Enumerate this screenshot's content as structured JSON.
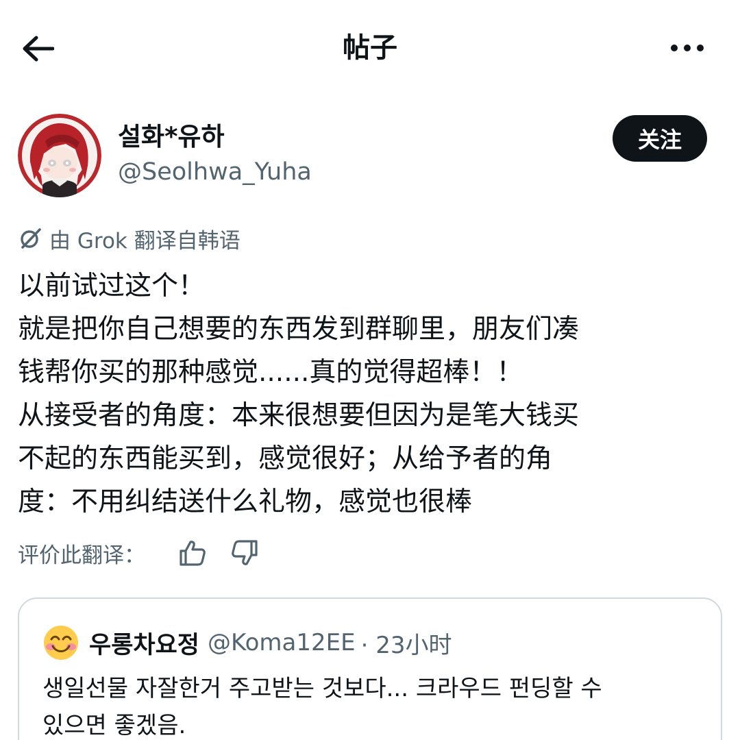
{
  "header": {
    "title": "帖子"
  },
  "author": {
    "name": "설화*유하",
    "handle": "@Seolhwa_Yuha",
    "follow_label": "关注"
  },
  "translation": {
    "note": "由 Grok 翻译自韩语"
  },
  "post": {
    "lines": [
      "以前试过这个！",
      "就是把你自己想要的东西发到群聊里，朋友们凑",
      "钱帮你买的那种感觉......真的觉得超棒！！",
      "从接受者的角度：本来很想要但因为是笔大钱买",
      "不起的东西能买到，感觉很好；从给予者的角",
      "度：不用纠结送什么礼物，感觉也很棒"
    ]
  },
  "rating": {
    "label": "评价此翻译："
  },
  "quote": {
    "name": "우롱차요정",
    "handle": "@Koma12EE",
    "time": "· 23小时",
    "lines": [
      "생일선물 자잘한거 주고받는 것보다... 크라우드 펀딩할 수",
      "있으면 좋겠음."
    ]
  },
  "icons": {
    "back": "arrow-left-icon",
    "more": "more-horizontal-icon",
    "grok": "grok-logo-icon",
    "thumbs_up": "thumbs-up-icon",
    "thumbs_down": "thumbs-down-icon",
    "emoji": "smiling-face-emoji"
  },
  "colors": {
    "text": "#0f1419",
    "secondary": "#536471",
    "follow_bg": "#0f1419",
    "border": "#cfd9de",
    "avatar_red": "#c0262b"
  }
}
